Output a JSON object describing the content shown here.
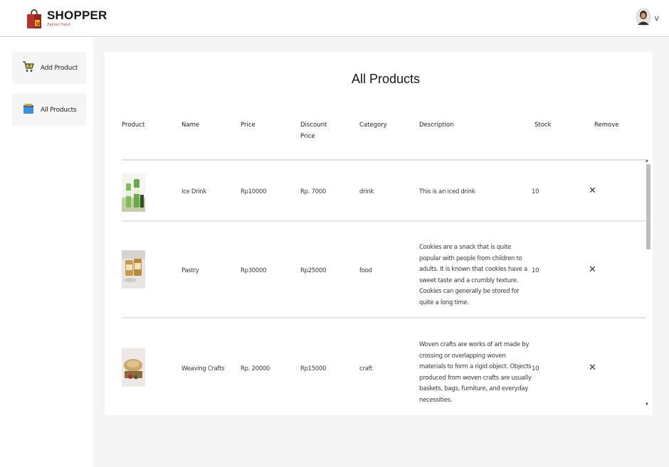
{
  "header": {
    "logo_title": "SHOPPER",
    "logo_subtitle": "Zainuri Yusuf",
    "profile_caret": "v"
  },
  "sidebar": {
    "items": [
      {
        "label": "Add Product",
        "icon": "cart-add-icon"
      },
      {
        "label": "All Products",
        "icon": "product-list-icon"
      }
    ]
  },
  "main": {
    "title": "All Products",
    "columns": [
      "Product",
      "Name",
      "Price",
      "Discount Price",
      "Category",
      "Description",
      "Stock",
      "Remove"
    ],
    "rows": [
      {
        "name": "Ice Drink",
        "price": "Rp10000",
        "discount_price": "Rp. 7000",
        "category": "drink",
        "description": "This is an iced drink",
        "stock": "10",
        "remove": "✕"
      },
      {
        "name": "Pastry",
        "price": "Rp30000",
        "discount_price": "Rp25000",
        "category": "food",
        "description": "Cookies are a snack that is quite popular with people from children to adults. It is known that cookies have a sweet taste and a crumbly texture. Cookies can generally be stored for quite a long time.",
        "stock": "10",
        "remove": "✕"
      },
      {
        "name": "Weaving Crafts",
        "price": "Rp. 20000",
        "discount_price": "Rp15000",
        "category": "craft",
        "description": "Woven crafts are works of art made by crossing or overlapping woven materials to form a rigid object. Objects produced from woven crafts are usually baskets, bags, furniture, and everyday necessities.",
        "stock": "10",
        "remove": "✕"
      }
    ]
  },
  "colors": {
    "accent_red": "#c0392b",
    "panel_bg": "#f5f5f5",
    "divider": "#e0e0e0"
  }
}
